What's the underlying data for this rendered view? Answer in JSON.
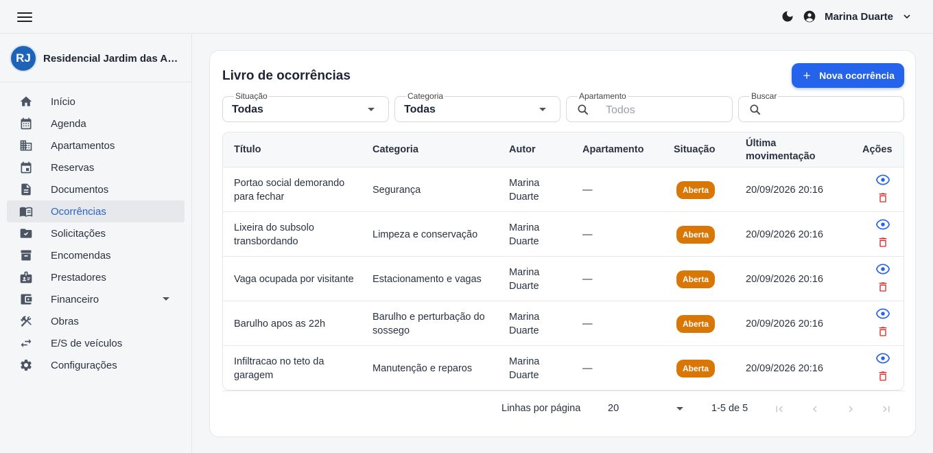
{
  "header": {
    "user_name": "Marina Duarte"
  },
  "sidebar": {
    "org_initials": "RJ",
    "org_name": "Residencial Jardim das Acácias",
    "items": [
      {
        "label": "Início",
        "icon": "home-icon"
      },
      {
        "label": "Agenda",
        "icon": "calendar-icon"
      },
      {
        "label": "Apartamentos",
        "icon": "building-icon"
      },
      {
        "label": "Reservas",
        "icon": "event-icon"
      },
      {
        "label": "Documentos",
        "icon": "document-icon"
      },
      {
        "label": "Ocorrências",
        "icon": "book-icon",
        "active": true
      },
      {
        "label": "Solicitações",
        "icon": "folder-icon"
      },
      {
        "label": "Encomendas",
        "icon": "archive-icon"
      },
      {
        "label": "Prestadores",
        "icon": "badge-icon"
      },
      {
        "label": "Financeiro",
        "icon": "wallet-icon",
        "expandable": true
      },
      {
        "label": "Obras",
        "icon": "tools-icon"
      },
      {
        "label": "E/S de veículos",
        "icon": "swap-icon"
      },
      {
        "label": "Configurações",
        "icon": "gear-icon"
      }
    ]
  },
  "main": {
    "title": "Livro de ocorrências",
    "new_button": "Nova ocorrência",
    "filters": {
      "situacao": {
        "label": "Situação",
        "value": "Todas"
      },
      "categoria": {
        "label": "Categoria",
        "value": "Todas"
      },
      "apartamento": {
        "label": "Apartamento",
        "placeholder": "Todos"
      },
      "buscar": {
        "label": "Buscar",
        "value": ""
      }
    },
    "table": {
      "columns": [
        "Título",
        "Categoria",
        "Autor",
        "Apartamento",
        "Situação",
        "Última movimentação",
        "Ações"
      ],
      "rows": [
        {
          "titulo": "Portao social demorando para fechar",
          "categoria": "Segurança",
          "autor": "Marina Duarte",
          "apartamento": "—",
          "situacao": "Aberta",
          "movimentacao": "20/09/2026 20:16"
        },
        {
          "titulo": "Lixeira do subsolo transbordando",
          "categoria": "Limpeza e conservação",
          "autor": "Marina Duarte",
          "apartamento": "—",
          "situacao": "Aberta",
          "movimentacao": "20/09/2026 20:16"
        },
        {
          "titulo": "Vaga ocupada por visitante",
          "categoria": "Estacionamento e vagas",
          "autor": "Marina Duarte",
          "apartamento": "—",
          "situacao": "Aberta",
          "movimentacao": "20/09/2026 20:16"
        },
        {
          "titulo": "Barulho apos as 22h",
          "categoria": "Barulho e perturbação do sossego",
          "autor": "Marina Duarte",
          "apartamento": "—",
          "situacao": "Aberta",
          "movimentacao": "20/09/2026 20:16"
        },
        {
          "titulo": "Infiltracao no teto da garagem",
          "categoria": "Manutenção e reparos",
          "autor": "Marina Duarte",
          "apartamento": "—",
          "situacao": "Aberta",
          "movimentacao": "20/09/2026 20:16"
        }
      ]
    },
    "pagination": {
      "rows_label": "Linhas por página",
      "rows_per_page": "20",
      "range": "1-5 de 5"
    }
  },
  "colors": {
    "accent": "#2563eb",
    "badge_open": "#d97706",
    "danger": "#dc2626",
    "active_nav_text": "#2b63c4"
  }
}
